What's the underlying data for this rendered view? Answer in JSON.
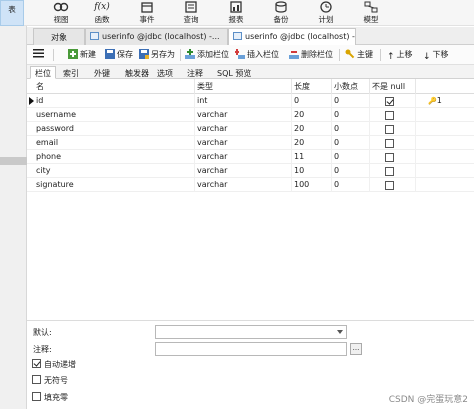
{
  "ribbon": {
    "items": [
      {
        "label": "表",
        "icon": "table-icon"
      },
      {
        "label": "视图",
        "icon": "view-icon"
      },
      {
        "label": "函数",
        "icon": "function-icon"
      },
      {
        "label": "事件",
        "icon": "event-icon"
      },
      {
        "label": "查询",
        "icon": "query-icon"
      },
      {
        "label": "报表",
        "icon": "report-icon"
      },
      {
        "label": "备份",
        "icon": "backup-icon"
      },
      {
        "label": "计划",
        "icon": "schedule-icon"
      },
      {
        "label": "模型",
        "icon": "model-icon"
      }
    ],
    "function_glyph": "f(x)"
  },
  "tabs": [
    {
      "label": "对象"
    },
    {
      "label": "userinfo @jdbc (localhost) -..."
    },
    {
      "label": "userinfo @jdbc (localhost) -..."
    }
  ],
  "toolbar": {
    "menu_icon": "hamburger-menu-icon",
    "new": "新建",
    "save": "保存",
    "save_as": "另存为",
    "add_field": "添加栏位",
    "insert_field": "插入栏位",
    "delete_field": "删除栏位",
    "primary_key": "主键",
    "move_up": "上移",
    "move_down": "下移"
  },
  "subtabs": [
    "栏位",
    "索引",
    "外键",
    "触发器",
    "选项",
    "注释",
    "SQL 预览"
  ],
  "grid": {
    "headers": {
      "name": "名",
      "type": "类型",
      "length": "长度",
      "decimals": "小数点",
      "not_null": "不是 null"
    },
    "rows": [
      {
        "name": "id",
        "type": "int",
        "length": "0",
        "decimals": "0",
        "not_null": true,
        "key": "1",
        "current": true
      },
      {
        "name": "username",
        "type": "varchar",
        "length": "20",
        "decimals": "0",
        "not_null": false,
        "key": ""
      },
      {
        "name": "password",
        "type": "varchar",
        "length": "20",
        "decimals": "0",
        "not_null": false,
        "key": ""
      },
      {
        "name": "email",
        "type": "varchar",
        "length": "20",
        "decimals": "0",
        "not_null": false,
        "key": ""
      },
      {
        "name": "phone",
        "type": "varchar",
        "length": "11",
        "decimals": "0",
        "not_null": false,
        "key": ""
      },
      {
        "name": "city",
        "type": "varchar",
        "length": "10",
        "decimals": "0",
        "not_null": false,
        "key": ""
      },
      {
        "name": "signature",
        "type": "varchar",
        "length": "100",
        "decimals": "0",
        "not_null": false,
        "key": ""
      }
    ]
  },
  "properties": {
    "default_label": "默认:",
    "default_value": "",
    "comment_label": "注释:",
    "comment_value": "",
    "ellipsis": "...",
    "checkboxes": [
      {
        "label": "自动递增",
        "checked": true
      },
      {
        "label": "无符号",
        "checked": false
      },
      {
        "label": "填充零",
        "checked": false
      }
    ]
  },
  "watermark": "CSDN @完蛋玩意2",
  "colors": {
    "accent": "#cfe3f7",
    "key_icon": "#d9a400"
  }
}
